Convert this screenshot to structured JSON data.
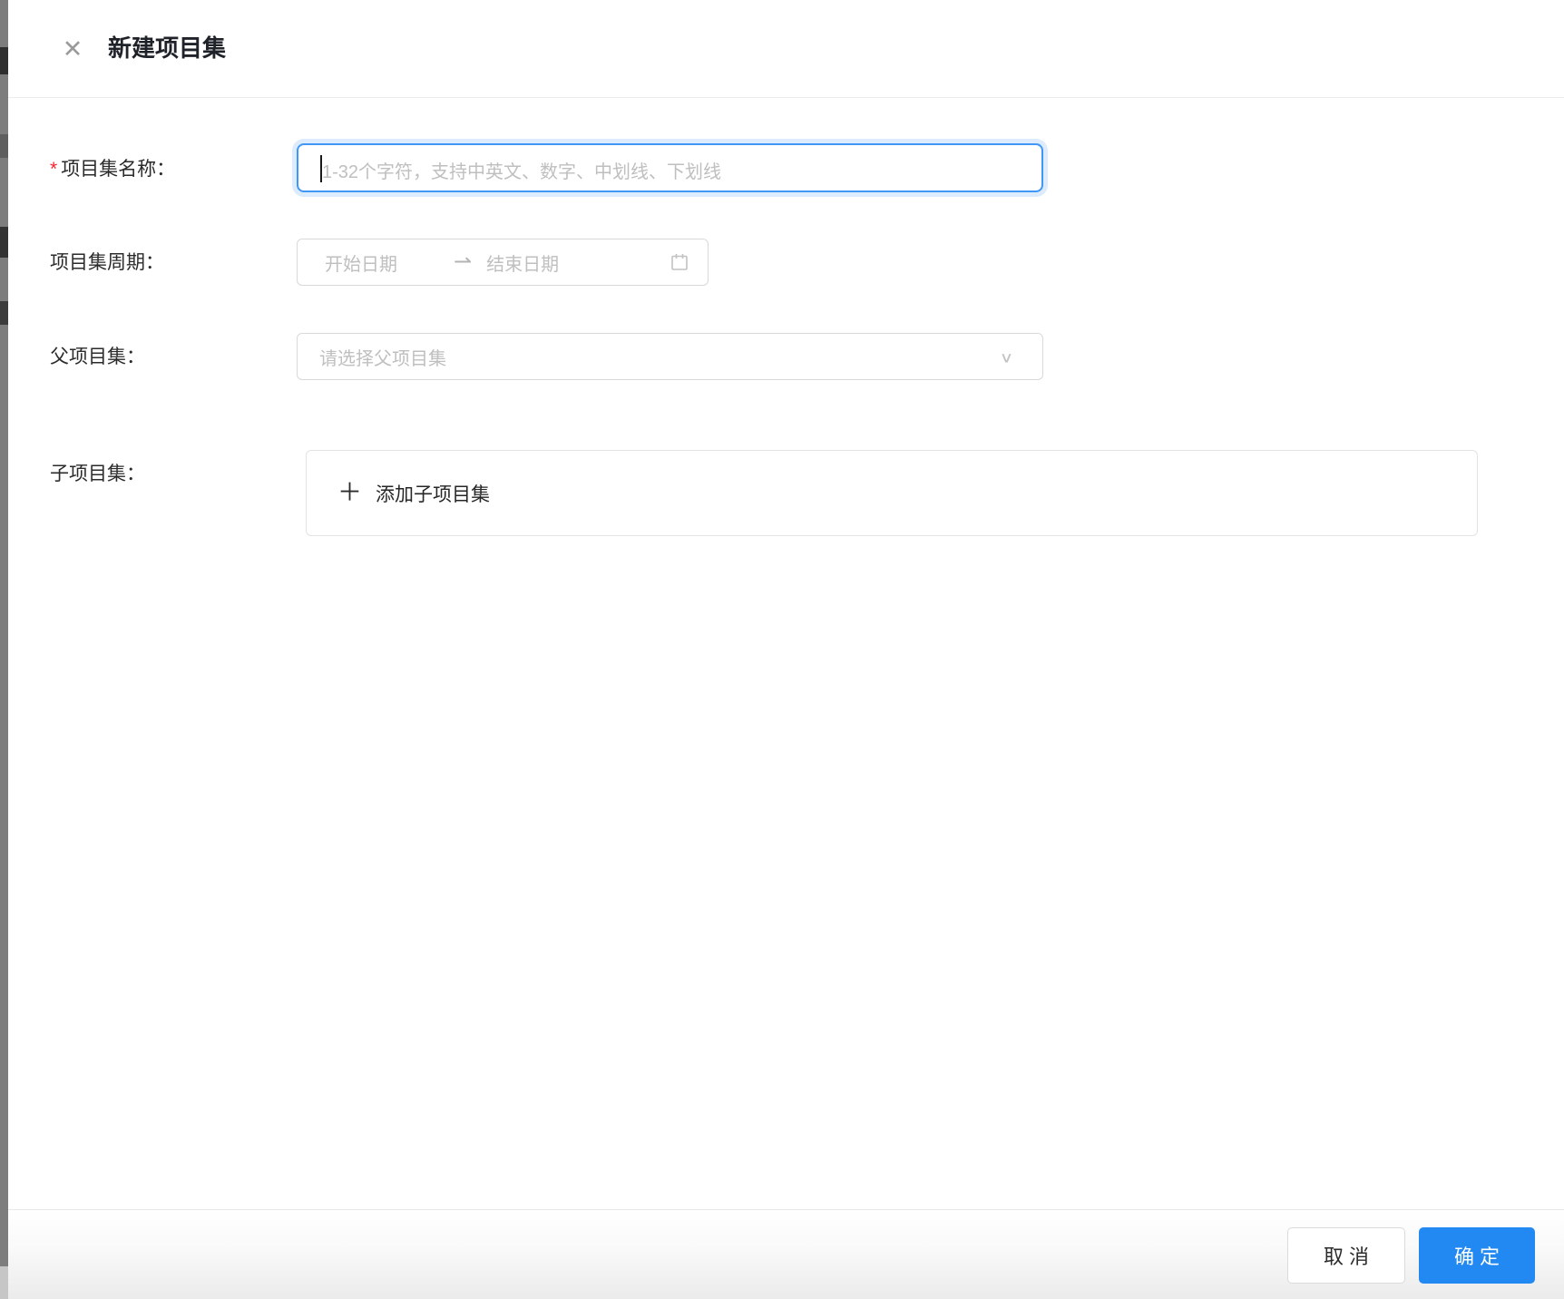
{
  "header": {
    "title": "新建项目集"
  },
  "icons": {
    "close": "✕",
    "swap_right": "⇀",
    "chevron_down": "∨",
    "plus": "＋"
  },
  "form": {
    "required_mark": "*",
    "name": {
      "label": "项目集名称：",
      "placeholder": "1-32个字符，支持中英文、数字、中划线、下划线"
    },
    "period": {
      "label": "项目集周期：",
      "start_placeholder": "开始日期",
      "end_placeholder": "结束日期"
    },
    "parent": {
      "label": "父项目集：",
      "placeholder": "请选择父项目集"
    },
    "children": {
      "label": "子项目集：",
      "add_label": "添加子项目集"
    }
  },
  "footer": {
    "cancel_label": "取 消",
    "ok_label": "确 定"
  },
  "colors": {
    "primary": "#2289f2",
    "focus_border": "#4097f5",
    "focus_glow": "rgba(36,130,245,0.16)",
    "danger": "#f5222d",
    "input_border": "#d9d9d9",
    "placeholder": "#bfbfbf"
  }
}
